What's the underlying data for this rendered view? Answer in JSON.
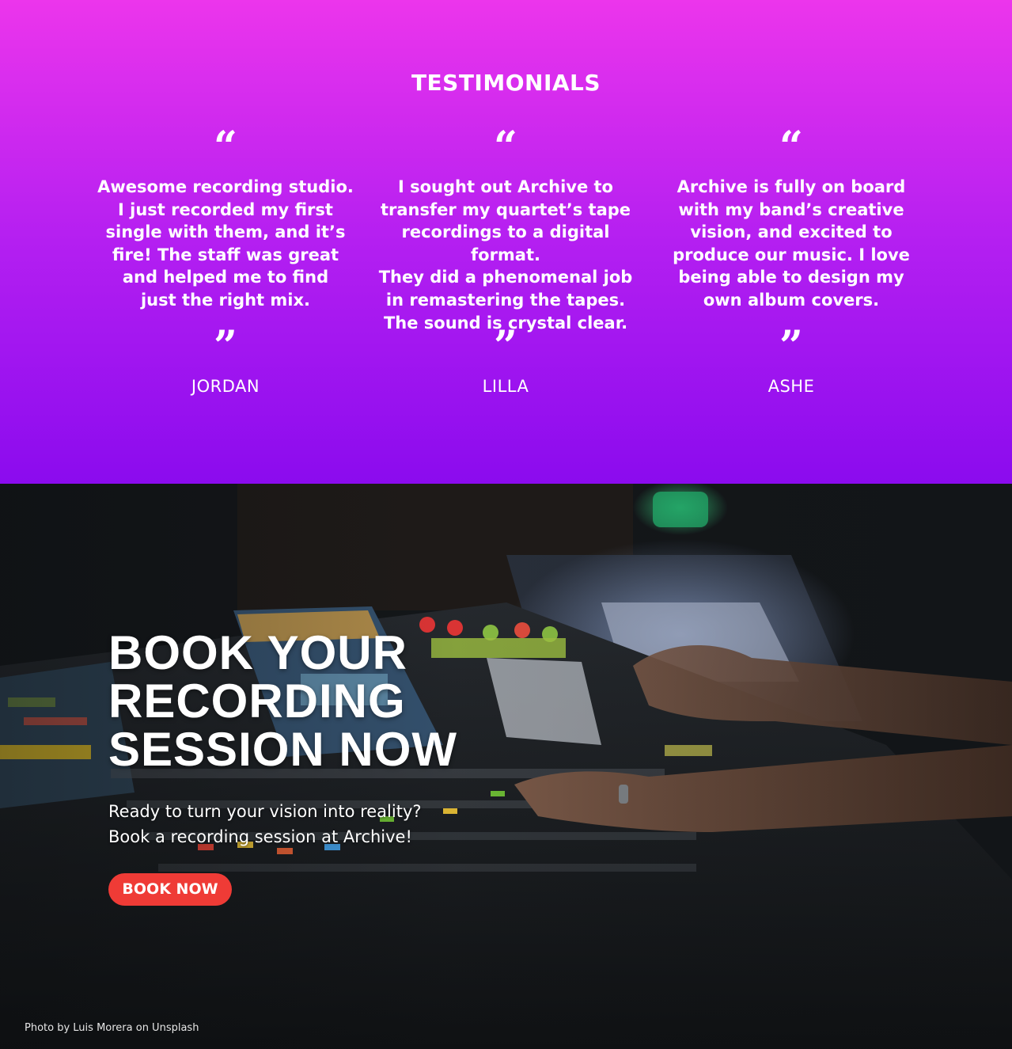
{
  "testimonials": {
    "heading": "TESTIMONIALS",
    "open_quote": "“",
    "close_quote": "”",
    "items": [
      {
        "quote": "Awesome recording studio.\nI just recorded my first\nsingle with them, and it’s\nfire! The staff was great\nand helped me to find\njust the right mix.",
        "author": "JORDAN"
      },
      {
        "quote": "I sought out Archive to\ntransfer my quartet’s tape\nrecordings to a digital format.\nThey did a phenomenal job\nin remastering the tapes.\nThe sound is crystal clear.",
        "author": "LILLA"
      },
      {
        "quote": "Archive is fully on board\nwith my band’s creative\nvision, and excited to\nproduce our music. I love\nbeing able to design my\nown album covers.",
        "author": "ASHE"
      }
    ]
  },
  "booking": {
    "title": "BOOK YOUR\nRECORDING\nSESSION NOW",
    "subtitle": "Ready to turn your vision into reality?\nBook a recording session at Archive!",
    "button_label": "BOOK NOW",
    "photo_credit": "Photo by Luis Morera on Unsplash",
    "button_color": "#ef3b36"
  },
  "colors": {
    "gradient_top": "#ec35ec",
    "gradient_bottom": "#8b0bee"
  }
}
